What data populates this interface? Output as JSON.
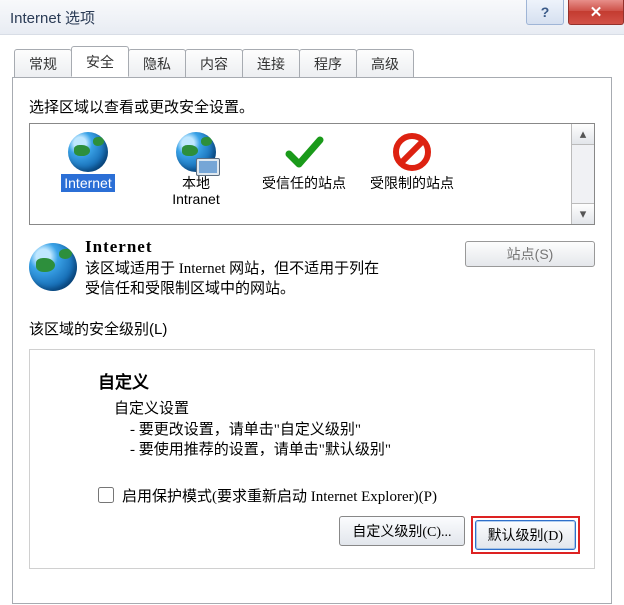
{
  "title": "Internet 选项",
  "tabs": [
    "常规",
    "安全",
    "隐私",
    "内容",
    "连接",
    "程序",
    "高级"
  ],
  "active_tab": 1,
  "zone_prompt": "选择区域以查看或更改安全设置。",
  "zones": [
    {
      "label": "Internet",
      "selected": true
    },
    {
      "label": "本地\nIntranet",
      "selected": false
    },
    {
      "label": "受信任的站点",
      "selected": false
    },
    {
      "label": "受限制的站点",
      "selected": false
    }
  ],
  "sites_button": "站点(S)",
  "zone_name": "Internet",
  "zone_desc": "该区域适用于 Internet 网站，但不适用于列在受信任和受限制区域中的网站。",
  "level_legend": "该区域的安全级别(L)",
  "level_head": "自定义",
  "level_sub": "自定义设置",
  "level_bullets": [
    "- 要更改设置，请单击\"自定义级别\"",
    "- 要使用推荐的设置，请单击\"默认级别\""
  ],
  "protect_label": "启用保护模式(要求重新启动 Internet Explorer)(P)",
  "custom_btn": "自定义级别(C)...",
  "default_btn": "默认级别(D)"
}
